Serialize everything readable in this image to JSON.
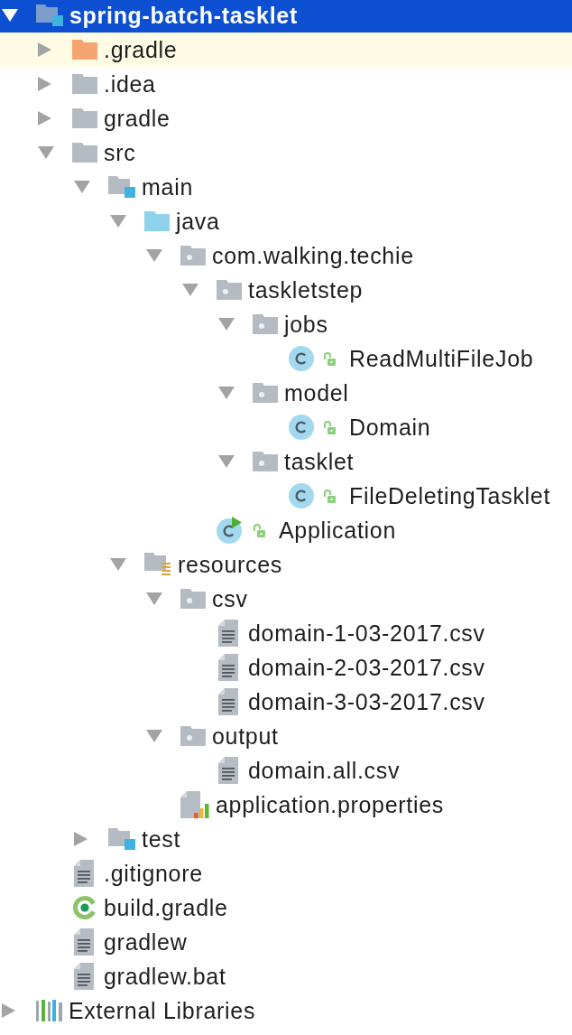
{
  "project_tree": [
    {
      "name": "spring-batch-tasklet",
      "kind": "module",
      "expanded": true,
      "selected": true,
      "highlighted": false,
      "children": [
        {
          "name": ".gradle",
          "kind": "excluded-folder",
          "expanded": false,
          "selected": false,
          "highlighted": true
        },
        {
          "name": ".idea",
          "kind": "folder",
          "expanded": false,
          "selected": false,
          "highlighted": false
        },
        {
          "name": "gradle",
          "kind": "folder",
          "expanded": false,
          "selected": false,
          "highlighted": false
        },
        {
          "name": "src",
          "kind": "folder",
          "expanded": true,
          "selected": false,
          "highlighted": false,
          "children": [
            {
              "name": "main",
              "kind": "module",
              "expanded": true,
              "selected": false,
              "highlighted": false,
              "children": [
                {
                  "name": "java",
                  "kind": "source-folder",
                  "expanded": true,
                  "selected": false,
                  "highlighted": false,
                  "children": [
                    {
                      "name": "com.walking.techie",
                      "kind": "package",
                      "expanded": true,
                      "selected": false,
                      "highlighted": false,
                      "children": [
                        {
                          "name": "taskletstep",
                          "kind": "package",
                          "expanded": true,
                          "selected": false,
                          "highlighted": false,
                          "children": [
                            {
                              "name": "jobs",
                              "kind": "package",
                              "expanded": true,
                              "selected": false,
                              "highlighted": false,
                              "children": [
                                {
                                  "name": "ReadMultiFileJob",
                                  "kind": "class",
                                  "selected": false,
                                  "highlighted": false
                                }
                              ]
                            },
                            {
                              "name": "model",
                              "kind": "package",
                              "expanded": true,
                              "selected": false,
                              "highlighted": false,
                              "children": [
                                {
                                  "name": "Domain",
                                  "kind": "class",
                                  "selected": false,
                                  "highlighted": false
                                }
                              ]
                            },
                            {
                              "name": "tasklet",
                              "kind": "package",
                              "expanded": true,
                              "selected": false,
                              "highlighted": false,
                              "children": [
                                {
                                  "name": "FileDeletingTasklet",
                                  "kind": "class",
                                  "selected": false,
                                  "highlighted": false
                                }
                              ]
                            }
                          ]
                        },
                        {
                          "name": "Application",
                          "kind": "main-class",
                          "selected": false,
                          "highlighted": false
                        }
                      ]
                    }
                  ]
                },
                {
                  "name": "resources",
                  "kind": "resources-folder",
                  "expanded": true,
                  "selected": false,
                  "highlighted": false,
                  "children": [
                    {
                      "name": "csv",
                      "kind": "package",
                      "expanded": true,
                      "selected": false,
                      "highlighted": false,
                      "children": [
                        {
                          "name": "domain-1-03-2017.csv",
                          "kind": "text-file",
                          "selected": false,
                          "highlighted": false
                        },
                        {
                          "name": "domain-2-03-2017.csv",
                          "kind": "text-file",
                          "selected": false,
                          "highlighted": false
                        },
                        {
                          "name": "domain-3-03-2017.csv",
                          "kind": "text-file",
                          "selected": false,
                          "highlighted": false
                        }
                      ]
                    },
                    {
                      "name": "output",
                      "kind": "package",
                      "expanded": true,
                      "selected": false,
                      "highlighted": false,
                      "children": [
                        {
                          "name": "domain.all.csv",
                          "kind": "text-file",
                          "selected": false,
                          "highlighted": false
                        }
                      ]
                    },
                    {
                      "name": "application.properties",
                      "kind": "properties-file",
                      "selected": false,
                      "highlighted": false
                    }
                  ]
                }
              ]
            },
            {
              "name": "test",
              "kind": "module",
              "expanded": false,
              "selected": false,
              "highlighted": false
            }
          ]
        },
        {
          "name": ".gitignore",
          "kind": "text-file",
          "selected": false,
          "highlighted": false
        },
        {
          "name": "build.gradle",
          "kind": "gradle-file",
          "selected": false,
          "highlighted": false
        },
        {
          "name": "gradlew",
          "kind": "text-file",
          "selected": false,
          "highlighted": false
        },
        {
          "name": "gradlew.bat",
          "kind": "text-file",
          "selected": false,
          "highlighted": false
        }
      ]
    },
    {
      "name": "External Libraries",
      "kind": "libraries",
      "expanded": false,
      "selected": false,
      "highlighted": false
    }
  ]
}
